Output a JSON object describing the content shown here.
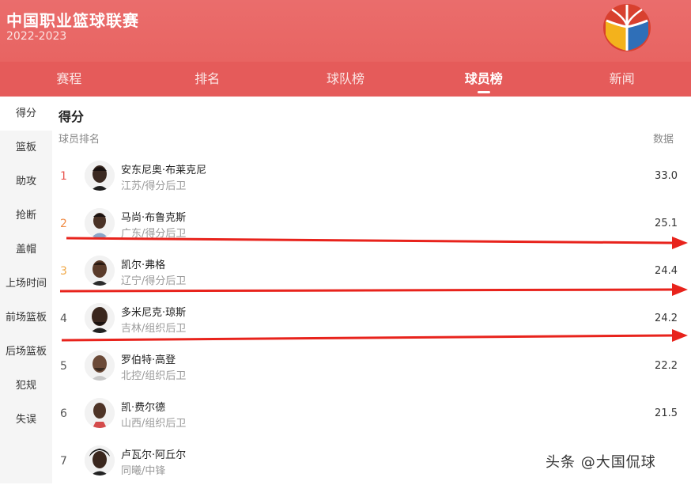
{
  "header": {
    "title": "中国职业篮球联赛",
    "season": "2022-2023"
  },
  "nav": {
    "tabs": [
      "赛程",
      "排名",
      "球队榜",
      "球员榜",
      "新闻"
    ]
  },
  "sidebar": {
    "items": [
      "得分",
      "篮板",
      "助攻",
      "抢断",
      "盖帽",
      "上场时间",
      "前场篮板",
      "后场篮板",
      "犯规",
      "失误"
    ]
  },
  "main": {
    "section_title": "得分",
    "col_left": "球员排名",
    "col_right": "数据",
    "players": [
      {
        "rank": "1",
        "name": "安东尼奥·布莱克尼",
        "team": "江苏/得分后卫",
        "value": "33.0"
      },
      {
        "rank": "2",
        "name": "马尚·布鲁克斯",
        "team": "广东/得分后卫",
        "value": "25.1"
      },
      {
        "rank": "3",
        "name": "凯尔·弗格",
        "team": "辽宁/得分后卫",
        "value": "24.4"
      },
      {
        "rank": "4",
        "name": "多米尼克·琼斯",
        "team": "吉林/组织后卫",
        "value": "24.2"
      },
      {
        "rank": "5",
        "name": "罗伯特·高登",
        "team": "北控/组织后卫",
        "value": "22.2"
      },
      {
        "rank": "6",
        "name": "凯·费尔德",
        "team": "山西/组织后卫",
        "value": "21.5"
      },
      {
        "rank": "7",
        "name": "卢瓦尔·阿丘尔",
        "team": "同曦/中锋",
        "value": ""
      }
    ]
  },
  "watermark": "头条 @大国侃球",
  "colors": {
    "header": "#e86462",
    "nav": "#e55b5a",
    "arrow": "#e8231c"
  }
}
